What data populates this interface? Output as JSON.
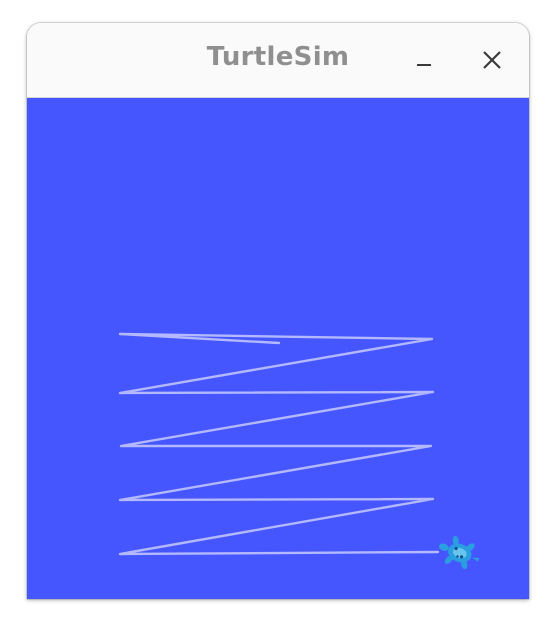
{
  "window": {
    "title": "TurtleSim"
  },
  "titlebar_buttons": {
    "minimize_icon": "minimize-icon",
    "close_icon": "close-icon"
  },
  "colors": {
    "canvas_background": "#4556ff",
    "pen_color": "#b3b8ff",
    "turtle_body": "#2a9fe0",
    "title_text": "#8f8f8f"
  }
}
